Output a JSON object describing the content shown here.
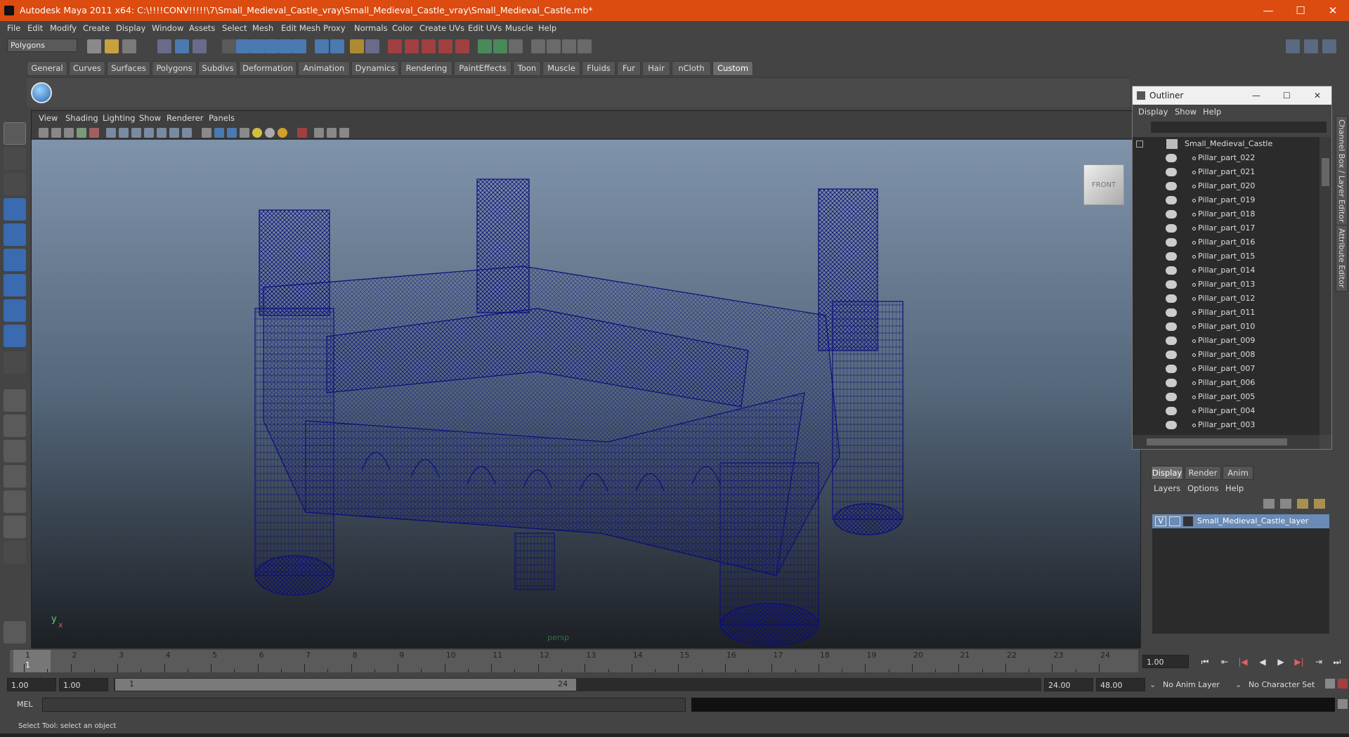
{
  "window": {
    "title": "Autodesk Maya 2011 x64: C:\\!!!!CONV!!!!!\\7\\Small_Medieval_Castle_vray\\Small_Medieval_Castle_vray\\Small_Medieval_Castle.mb*",
    "minimize": "—",
    "maximize": "☐",
    "close": "✕"
  },
  "menubar": [
    "File",
    "Edit",
    "Modify",
    "Create",
    "Display",
    "Window",
    "Assets",
    "Select",
    "Mesh",
    "Edit Mesh",
    "Proxy",
    "Normals",
    "Color",
    "Create UVs",
    "Edit UVs",
    "Muscle",
    "Help"
  ],
  "mode_selector": "Polygons",
  "shelf_tabs": [
    "General",
    "Curves",
    "Surfaces",
    "Polygons",
    "Subdivs",
    "Deformation",
    "Animation",
    "Dynamics",
    "Rendering",
    "PaintEffects",
    "Toon",
    "Muscle",
    "Fluids",
    "Fur",
    "Hair",
    "nCloth",
    "Custom"
  ],
  "active_shelf_tab": "Custom",
  "viewport": {
    "menus": [
      "View",
      "Shading",
      "Lighting",
      "Show",
      "Renderer",
      "Panels"
    ],
    "camera_label": "persp",
    "viewcube_label": "FRONT",
    "axis_y": "y",
    "axis_x": "x",
    "wire_color": "#0b0f7a"
  },
  "outliner": {
    "title": "Outliner",
    "menus": [
      "Display",
      "Show",
      "Help"
    ],
    "root": "Small_Medieval_Castle",
    "items": [
      "Pillar_part_022",
      "Pillar_part_021",
      "Pillar_part_020",
      "Pillar_part_019",
      "Pillar_part_018",
      "Pillar_part_017",
      "Pillar_part_016",
      "Pillar_part_015",
      "Pillar_part_014",
      "Pillar_part_013",
      "Pillar_part_012",
      "Pillar_part_011",
      "Pillar_part_010",
      "Pillar_part_009",
      "Pillar_part_008",
      "Pillar_part_007",
      "Pillar_part_006",
      "Pillar_part_005",
      "Pillar_part_004",
      "Pillar_part_003"
    ]
  },
  "side_tabs": [
    "Channel Box / Layer Editor",
    "Attribute Editor"
  ],
  "layer_editor": {
    "tabs": [
      "Display",
      "Render",
      "Anim"
    ],
    "active_tab": "Display",
    "menus": [
      "Layers",
      "Options",
      "Help"
    ],
    "layer": {
      "visibility": "V",
      "name": "Small_Medieval_Castle_layer"
    }
  },
  "timeline": {
    "ticks": [
      "1",
      "2",
      "3",
      "4",
      "5",
      "6",
      "7",
      "8",
      "9",
      "10",
      "11",
      "12",
      "13",
      "14",
      "15",
      "16",
      "17",
      "18",
      "19",
      "20",
      "21",
      "22",
      "23",
      "24"
    ],
    "current_frame": "1",
    "current_time_field": "1.00"
  },
  "range": {
    "start": "1.00",
    "playback_start": "1.00",
    "slider_start": "1",
    "slider_end": "24",
    "playback_end": "24.00",
    "end": "48.00",
    "anim_layer": "No Anim Layer",
    "character_set": "No Character Set"
  },
  "mel": {
    "label": "MEL"
  },
  "status": {
    "text": "Select Tool: select an object"
  }
}
